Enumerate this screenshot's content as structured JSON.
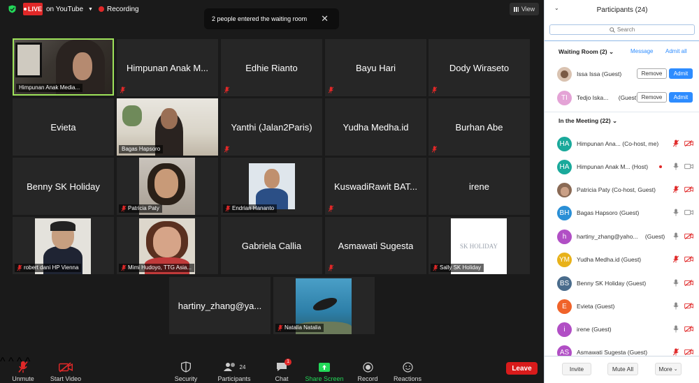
{
  "topbar": {
    "live_label": "LIVE",
    "stream_label": "on YouTube",
    "recording_label": "Recording",
    "view_label": "View"
  },
  "toast": {
    "message": "2 people entered the waiting room"
  },
  "tiles": {
    "t1": {
      "label": "Himpunan Anak Media..."
    },
    "t2": {
      "name": "Himpunan Anak M..."
    },
    "t3": {
      "name": "Edhie Rianto"
    },
    "t4": {
      "name": "Bayu Hari"
    },
    "t5": {
      "name": "Dody Wiraseto"
    },
    "t6": {
      "name": "Evieta"
    },
    "t7": {
      "label": "Bagas Hapsoro"
    },
    "t8": {
      "name": "Yanthi (Jalan2Paris)"
    },
    "t9": {
      "name": "Yudha Medha.id"
    },
    "t10": {
      "name": "Burhan Abe"
    },
    "t11": {
      "name": "Benny SK Holiday"
    },
    "t12": {
      "label": "Patricia Paty"
    },
    "t13": {
      "label": "Endrian Hananto"
    },
    "t14": {
      "name": "KuswadiRawit BAT..."
    },
    "t15": {
      "name": "irene"
    },
    "t16": {
      "label": "robert dani HP Vienna"
    },
    "t17": {
      "label": "Mimi Hudoyo, TTG Asia..."
    },
    "t18": {
      "name": "Gabriela Callia"
    },
    "t19": {
      "name": "Asmawati Sugesta"
    },
    "t20": {
      "label": "Sally SK Holiday",
      "logo_text": "SK HOLIDAY"
    },
    "t21": {
      "name": "hartiny_zhang@ya..."
    },
    "t22": {
      "label": "Natalia Natalia"
    }
  },
  "toolbar": {
    "unmute": "Unmute",
    "start_video": "Start Video",
    "security": "Security",
    "participants": "Participants",
    "participants_count": "24",
    "chat": "Chat",
    "chat_badge": "1",
    "share_screen": "Share Screen",
    "record": "Record",
    "reactions": "Reactions",
    "leave": "Leave"
  },
  "panel": {
    "title": "Participants (24)",
    "search_placeholder": "Search",
    "waiting_room_title": "Waiting Room (2)",
    "message_link": "Message",
    "admit_all_link": "Admit all",
    "waiting": [
      {
        "name": "Issa Issa (Guest)",
        "initials": ""
      },
      {
        "name": "Tedjo Iska...",
        "suffix": "(Guest)",
        "initials": "TI"
      }
    ],
    "remove_label": "Remove",
    "admit_label": "Admit",
    "in_meeting_title": "In the Meeting (22)",
    "members": [
      {
        "initials": "HA",
        "name": "Himpunan Ana...",
        "role": "(Co-host, me)"
      },
      {
        "initials": "HA",
        "name": "Himpunan Anak M...",
        "role": "(Host)"
      },
      {
        "initials": "",
        "name": "Patricia Paty (Co-host, Guest)",
        "role": ""
      },
      {
        "initials": "BH",
        "name": "Bagas Hapsoro (Guest)",
        "role": ""
      },
      {
        "initials": "h",
        "name": "hartiny_zhang@yaho...",
        "role": "(Guest)"
      },
      {
        "initials": "YM",
        "name": "Yudha Medha.id (Guest)",
        "role": ""
      },
      {
        "initials": "BS",
        "name": "Benny SK Holiday (Guest)",
        "role": ""
      },
      {
        "initials": "E",
        "name": "Evieta (Guest)",
        "role": ""
      },
      {
        "initials": "i",
        "name": "irene (Guest)",
        "role": ""
      },
      {
        "initials": "AS",
        "name": "Asmawati Sugesta (Guest)",
        "role": ""
      }
    ],
    "footer": {
      "invite": "Invite",
      "mute_all": "Mute All",
      "more": "More"
    }
  },
  "colors": {
    "accent_blue": "#2d8cff",
    "live_red": "#e02828",
    "active_speaker": "#9ee35a",
    "leave_red": "#d91b1b"
  }
}
